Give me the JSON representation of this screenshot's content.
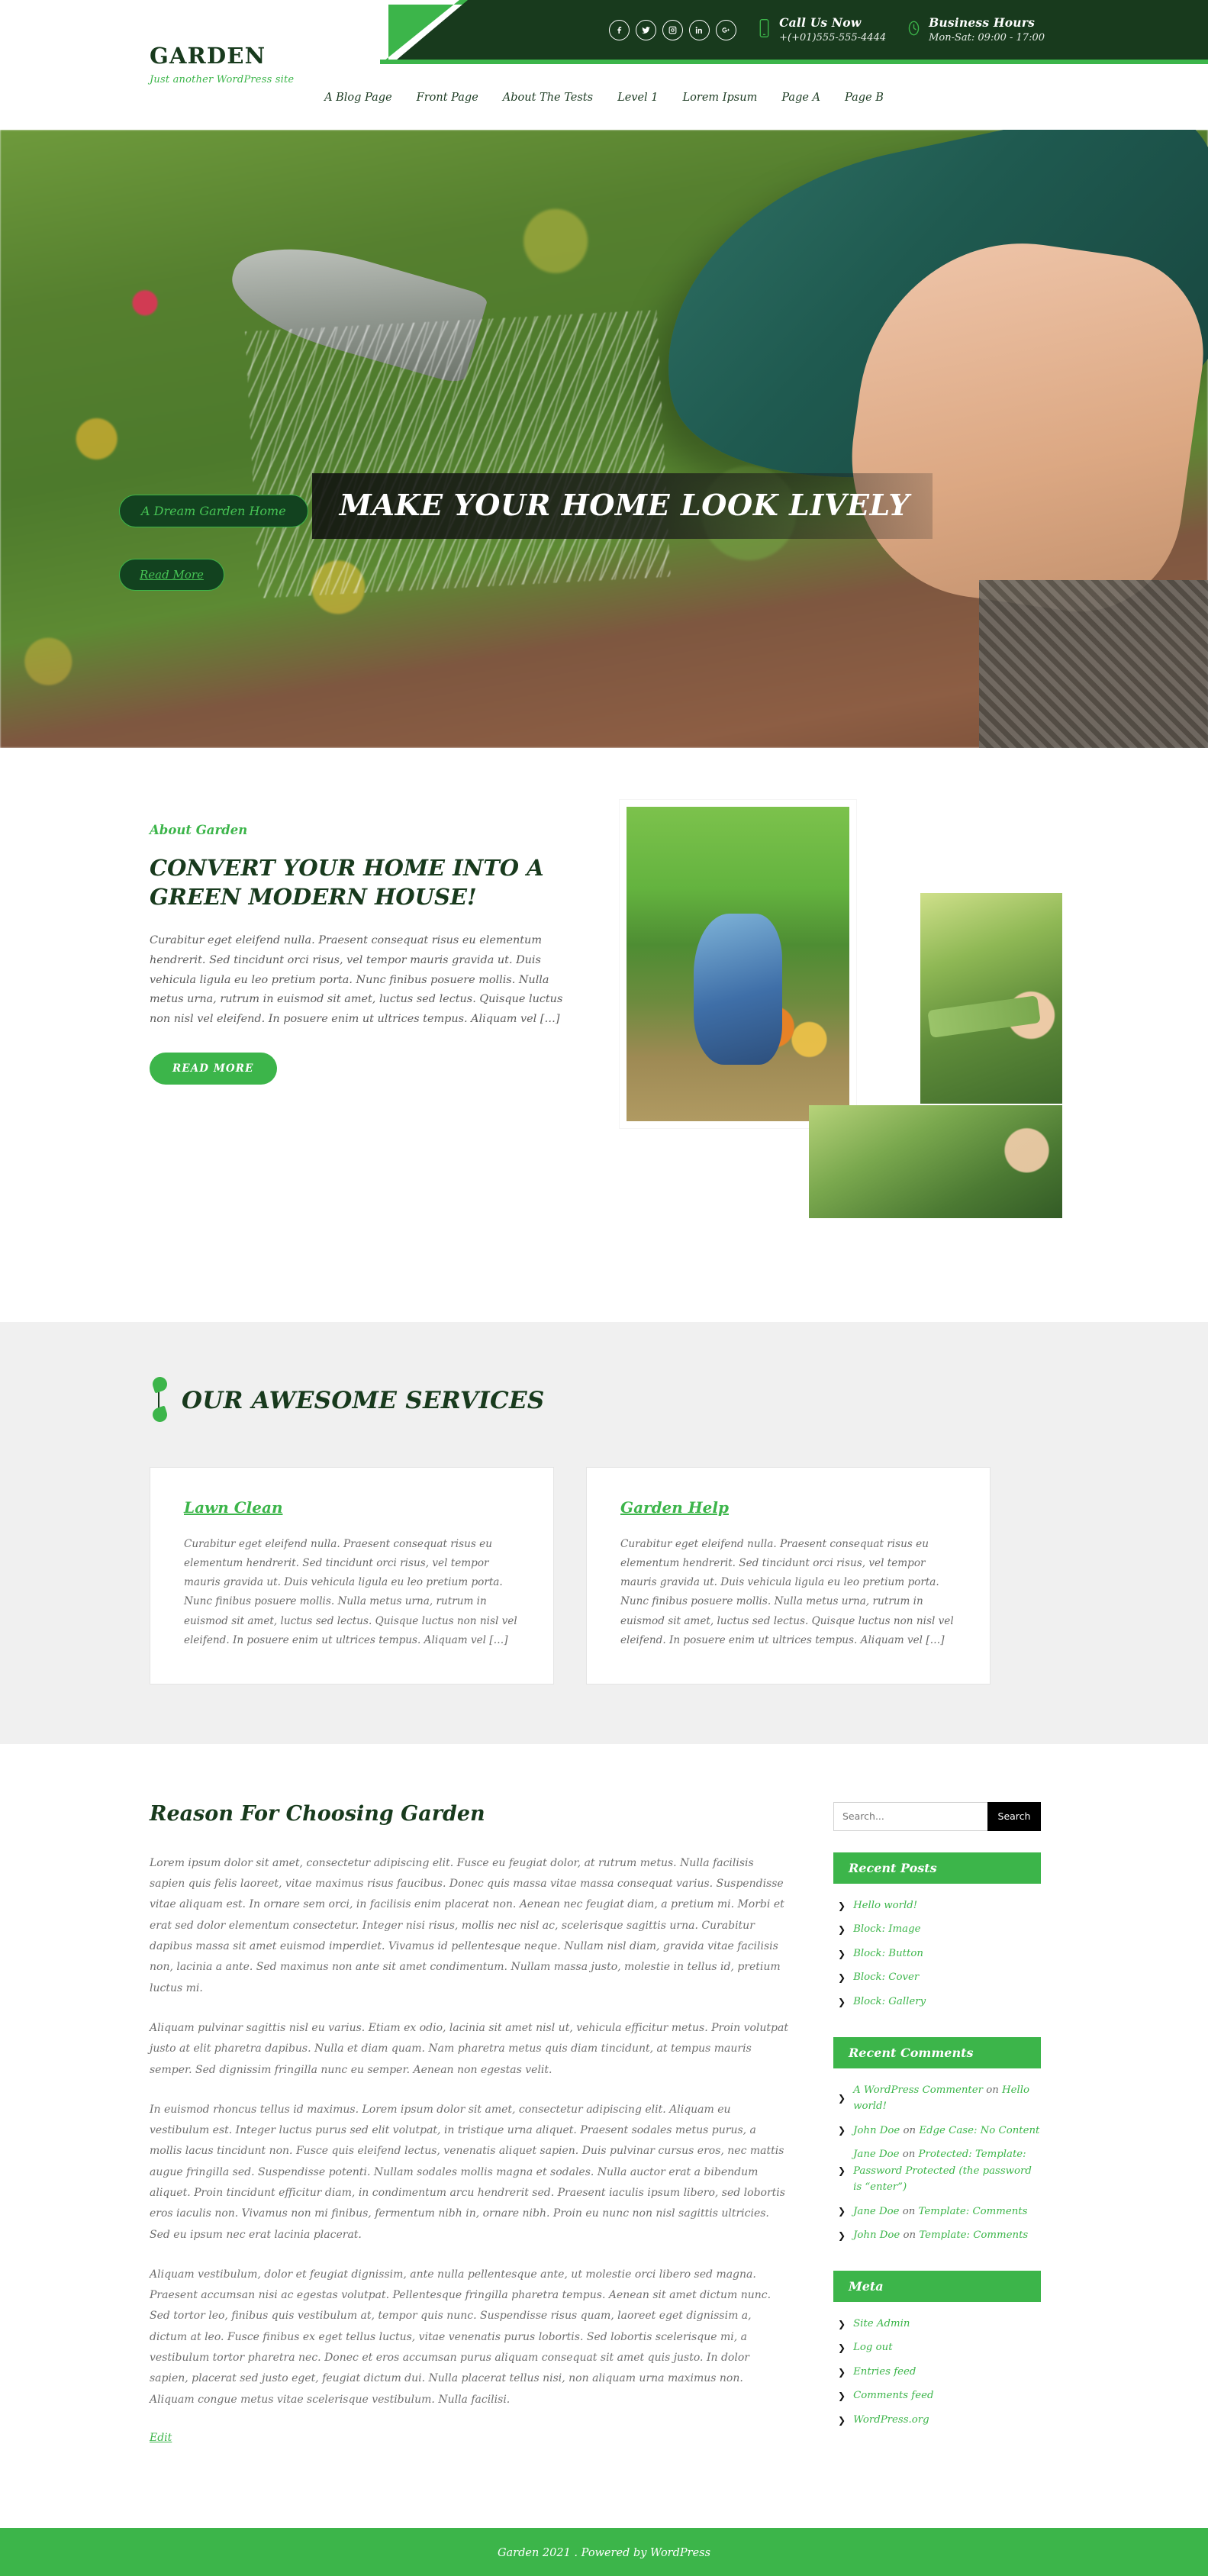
{
  "topbar": {
    "social": [
      {
        "name": "facebook-icon",
        "label": "f"
      },
      {
        "name": "twitter-icon",
        "label": "t"
      },
      {
        "name": "instagram-icon",
        "label": "ig"
      },
      {
        "name": "linkedin-icon",
        "label": "in"
      },
      {
        "name": "google-plus-icon",
        "label": "G+"
      }
    ],
    "phone": {
      "icon": "mobile-phone-icon",
      "title": "Call Us Now",
      "value": "+(+01)555-555-4444"
    },
    "hours": {
      "icon": "clock-icon",
      "title": "Business Hours",
      "value": "Mon-Sat: 09:00 - 17:00"
    }
  },
  "brand": {
    "title": "GARDEN",
    "tagline": "Just another WordPress site"
  },
  "nav": {
    "items": [
      {
        "label": "A Blog Page"
      },
      {
        "label": "Front Page"
      },
      {
        "label": "About The Tests"
      },
      {
        "label": "Level 1"
      },
      {
        "label": "Lorem Ipsum"
      },
      {
        "label": "Page A"
      },
      {
        "label": "Page B"
      }
    ]
  },
  "hero": {
    "badge": "A Dream Garden Home",
    "title": "MAKE YOUR HOME LOOK LIVELY",
    "button": "Read More"
  },
  "about": {
    "kicker": "About Garden",
    "heading": "CONVERT YOUR HOME INTO A GREEN MODERN HOUSE!",
    "body": "Curabitur eget eleifend nulla. Praesent consequat risus eu elementum hendrerit. Sed tincidunt orci risus, vel tempor mauris gravida ut. Duis vehicula ligula eu leo pretium porta. Nunc finibus posuere mollis. Nulla metus urna, rutrum in euismod sit amet, luctus sed lectus. Quisque luctus non nisl vel eleifend. In posuere enim ut ultrices tempus. Aliquam vel […]",
    "button": "READ MORE"
  },
  "services": {
    "title": "OUR AWESOME SERVICES",
    "cards": [
      {
        "title": "Lawn Clean",
        "body": "Curabitur eget eleifend nulla. Praesent consequat risus eu elementum hendrerit. Sed tincidunt orci risus, vel tempor mauris gravida ut. Duis vehicula ligula eu leo pretium porta. Nunc finibus posuere mollis. Nulla metus urna, rutrum in euismod sit amet, luctus sed lectus. Quisque luctus non nisl vel eleifend. In posuere enim ut ultrices tempus. Aliquam vel […]"
      },
      {
        "title": "Garden Help",
        "body": "Curabitur eget eleifend nulla. Praesent consequat risus eu elementum hendrerit. Sed tincidunt orci risus, vel tempor mauris gravida ut. Duis vehicula ligula eu leo pretium porta. Nunc finibus posuere mollis. Nulla metus urna, rutrum in euismod sit amet, luctus sed lectus. Quisque luctus non nisl vel eleifend. In posuere enim ut ultrices tempus. Aliquam vel […]"
      }
    ]
  },
  "post": {
    "title": "Reason For Choosing Garden",
    "paragraphs": [
      "Lorem ipsum dolor sit amet, consectetur adipiscing elit. Fusce eu feugiat dolor, at rutrum metus. Nulla facilisis sapien quis felis laoreet, vitae maximus risus faucibus. Donec quis massa vitae massa consequat varius. Suspendisse vitae aliquam est. In ornare sem orci, in facilisis enim placerat non. Aenean nec feugiat diam, a pretium mi. Morbi et erat sed dolor elementum consectetur. Integer nisi risus, mollis nec nisl ac, scelerisque sagittis urna. Curabitur dapibus massa sit amet euismod imperdiet. Vivamus id pellentesque neque. Nullam nisl diam, gravida vitae facilisis non, lacinia a ante. Sed maximus non ante sit amet condimentum. Nullam massa justo, molestie in tellus id, pretium luctus mi.",
      "Aliquam pulvinar sagittis nisl eu varius. Etiam ex odio, lacinia sit amet nisl ut, vehicula efficitur metus. Proin volutpat justo at elit pharetra dapibus. Nulla et diam quam. Nam pharetra metus quis diam tincidunt, at tempus mauris semper. Sed dignissim fringilla nunc eu semper. Aenean non egestas velit.",
      "In euismod rhoncus tellus id maximus. Lorem ipsum dolor sit amet, consectetur adipiscing elit. Aliquam eu vestibulum est. Integer luctus purus sed elit volutpat, in tristique urna aliquet. Praesent sodales metus purus, a mollis lacus tincidunt non. Fusce quis eleifend lectus, venenatis aliquet sapien. Duis pulvinar cursus eros, nec mattis augue fringilla sed. Suspendisse potenti. Nullam sodales mollis magna et sodales. Nulla auctor erat a bibendum aliquet. Proin tincidunt efficitur diam, in condimentum arcu hendrerit sed. Praesent iaculis ipsum libero, sed lobortis eros iaculis non. Vivamus non mi finibus, fermentum nibh in, ornare nibh. Proin eu nunc non nisl sagittis ultricies. Sed eu ipsum nec erat lacinia placerat.",
      "Aliquam vestibulum, dolor et feugiat dignissim, ante nulla pellentesque ante, ut molestie orci libero sed magna. Praesent accumsan nisi ac egestas volutpat. Pellentesque fringilla pharetra tempus. Aenean sit amet dictum nunc. Sed tortor leo, finibus quis vestibulum at, tempor quis nunc. Suspendisse risus quam, laoreet eget dignissim a, dictum at leo. Fusce finibus ex eget tellus luctus, vitae venenatis purus lobortis. Sed lobortis scelerisque mi, a vestibulum tortor pharetra nec. Donec et eros accumsan purus aliquam consequat sit amet quis justo. In dolor sapien, placerat sed justo eget, feugiat dictum dui. Nulla placerat tellus nisi, non aliquam urna maximus non. Aliquam congue metus vitae scelerisque vestibulum. Nulla facilisi."
    ],
    "edit_label": "Edit"
  },
  "sidebar": {
    "search": {
      "placeholder": "Search...",
      "button": "Search"
    },
    "recent_posts": {
      "title": "Recent Posts",
      "items": [
        {
          "text": "Hello world!"
        },
        {
          "text": "Block: Image"
        },
        {
          "text": "Block: Button"
        },
        {
          "text": "Block: Cover"
        },
        {
          "text": "Block: Gallery"
        }
      ]
    },
    "recent_comments": {
      "title": "Recent Comments",
      "items": [
        {
          "author": "A WordPress Commenter",
          "on": " on ",
          "post": "Hello world!"
        },
        {
          "author": "John Doe",
          "on": " on ",
          "post": "Edge Case: No Content"
        },
        {
          "author": "Jane Doe",
          "on": " on ",
          "post": "Protected: Template: Password Protected (the password is “enter”)"
        },
        {
          "author": "Jane Doe",
          "on": " on ",
          "post": "Template: Comments"
        },
        {
          "author": "John Doe",
          "on": " on ",
          "post": "Template: Comments"
        }
      ]
    },
    "meta": {
      "title": "Meta",
      "items": [
        {
          "text": "Site Admin"
        },
        {
          "text": "Log out"
        },
        {
          "text": "Entries feed"
        },
        {
          "text": "Comments feed"
        },
        {
          "text": "WordPress.org"
        }
      ]
    }
  },
  "footer": {
    "text": "Garden 2021 . Powered by WordPress"
  },
  "colors": {
    "accent": "#3cb54a",
    "dark": "#183a1d",
    "muted": "#6f6f6f"
  }
}
